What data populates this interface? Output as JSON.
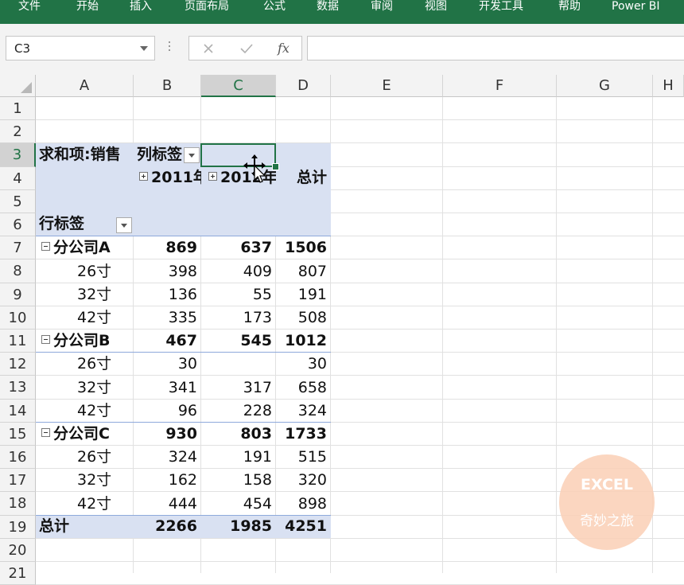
{
  "ribbon": {
    "tabs": [
      "文件",
      "开始",
      "插入",
      "页面布局",
      "公式",
      "数据",
      "审阅",
      "视图",
      "开发工具",
      "帮助",
      "Power BI"
    ]
  },
  "formula_bar": {
    "name_box": "C3",
    "cancel_icon": "cancel-x-icon",
    "enter_icon": "check-icon",
    "fx_label": "fx",
    "formula": ""
  },
  "sheet": {
    "columns": [
      "A",
      "B",
      "C",
      "D",
      "E",
      "F",
      "G",
      "H"
    ],
    "rows": [
      "1",
      "2",
      "3",
      "4",
      "5",
      "6",
      "7",
      "8",
      "9",
      "10",
      "11",
      "12",
      "13",
      "14",
      "15",
      "16",
      "17",
      "18",
      "19",
      "20",
      "21"
    ],
    "selected_cell": "C3",
    "colors": {
      "accent": "#217346",
      "pivot_band": "#d9e1f2",
      "pivot_rule": "#8ea9db"
    }
  },
  "pivot": {
    "values_label": "求和项:销售",
    "column_label": "列标签",
    "row_label": "行标签",
    "year1": "2011年",
    "year2": "2012年",
    "grand_total_header": "总计",
    "rows": [
      {
        "label": "分公司A",
        "v1": "869",
        "v2": "637",
        "total": "1506",
        "group": true
      },
      {
        "label": "26寸",
        "v1": "398",
        "v2": "409",
        "total": "807",
        "group": false
      },
      {
        "label": "32寸",
        "v1": "136",
        "v2": "55",
        "total": "191",
        "group": false
      },
      {
        "label": "42寸",
        "v1": "335",
        "v2": "173",
        "total": "508",
        "group": false
      },
      {
        "label": "分公司B",
        "v1": "467",
        "v2": "545",
        "total": "1012",
        "group": true
      },
      {
        "label": "26寸",
        "v1": "30",
        "v2": "",
        "total": "30",
        "group": false
      },
      {
        "label": "32寸",
        "v1": "341",
        "v2": "317",
        "total": "658",
        "group": false
      },
      {
        "label": "42寸",
        "v1": "96",
        "v2": "228",
        "total": "324",
        "group": false
      },
      {
        "label": "分公司C",
        "v1": "930",
        "v2": "803",
        "total": "1733",
        "group": true
      },
      {
        "label": "26寸",
        "v1": "324",
        "v2": "191",
        "total": "515",
        "group": false
      },
      {
        "label": "32寸",
        "v1": "162",
        "v2": "158",
        "total": "320",
        "group": false
      },
      {
        "label": "42寸",
        "v1": "444",
        "v2": "454",
        "total": "898",
        "group": false
      }
    ],
    "grand": {
      "label": "总计",
      "v1": "2266",
      "v2": "1985",
      "total": "4251"
    }
  },
  "watermark": {
    "line1": "EXCEL",
    "line2": "奇妙之旅"
  }
}
